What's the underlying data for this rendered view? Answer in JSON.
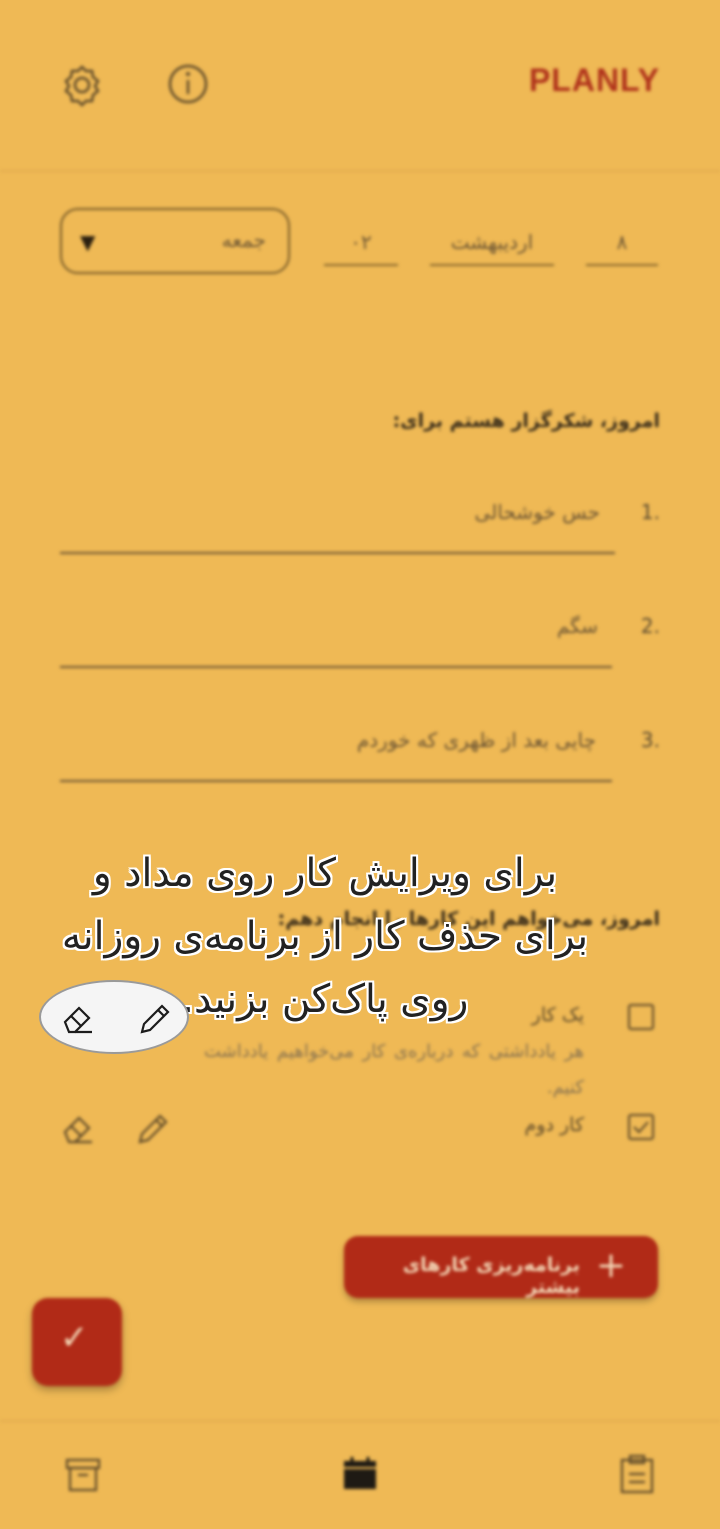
{
  "header": {
    "brand": "PLANLY",
    "settings_icon": "gear-icon",
    "info_icon": "info-icon"
  },
  "date": {
    "day": "۸",
    "month": "اردیبهشت",
    "year": "۰۲",
    "weekday": "جمعه"
  },
  "gratitude": {
    "title": "امروز، شکرگزار هستم برای:",
    "items": [
      {
        "num": "1.",
        "text": "حس خوشحالی"
      },
      {
        "num": "2.",
        "text": "سگم"
      },
      {
        "num": "3.",
        "text": "چایی بعد از ظهری که خوردم"
      }
    ]
  },
  "tasks": {
    "title": "امروز، می‌خواهم این کارها را انجام دهم:",
    "items": [
      {
        "title": "یک کار",
        "note": "هر یادداشتی که درباره‌ی کار می‌خواهیم یادداشت کنیم.",
        "checked": false
      },
      {
        "title": "کار دوم",
        "note": "",
        "checked": true
      }
    ],
    "edit_icon": "pencil-icon",
    "delete_icon": "eraser-icon"
  },
  "plan_button": {
    "label": "برنامه‌ریزی کارهای بیشتر"
  },
  "fab": {
    "icon": "check-icon"
  },
  "bottom_nav": {
    "items": [
      "archive-icon",
      "calendar-icon",
      "clipboard-icon"
    ]
  },
  "tooltip": {
    "text": "برای ویرایش کار روی مداد و برای حذف کار از برنامه‌ی روزانه روی پاک‌کن بزنید."
  },
  "colors": {
    "background": "#efb955",
    "accent": "#b12a17",
    "text": "#3b2e1b"
  }
}
